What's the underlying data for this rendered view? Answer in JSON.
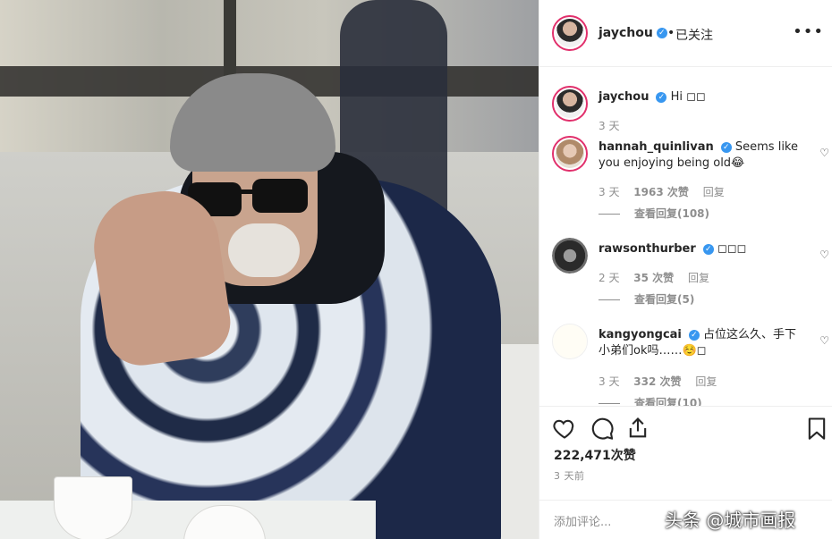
{
  "post": {
    "username": "jaychou",
    "follow_status": "已关注",
    "dot": "•",
    "more_icon": "more-horizontal-icon"
  },
  "comments": [
    {
      "user": "jaychou",
      "text": "Hi ◻◻",
      "time": "3 天",
      "likes": "",
      "reply": "",
      "view_replies": ""
    },
    {
      "user": "hannah_quinlivan",
      "text": "Seems like you enjoying being old😂",
      "time": "3 天",
      "likes": "1963 次赞",
      "reply": "回复",
      "view_replies": "查看回复(108)"
    },
    {
      "user": "rawsonthurber",
      "text": "◻◻◻",
      "time": "2 天",
      "likes": "35 次赞",
      "reply": "回复",
      "view_replies": "查看回复(5)"
    },
    {
      "user": "kangyongcai",
      "text": "占位这么久、手下小弟们ok吗……☺️◻",
      "time": "3 天",
      "likes": "332 次赞",
      "reply": "回复",
      "view_replies": "查看回复(10)"
    }
  ],
  "actions": {
    "like_icon": "heart-icon",
    "comment_icon": "comment-icon",
    "share_icon": "share-icon",
    "save_icon": "bookmark-icon"
  },
  "likes_total": "222,471次赞",
  "posted_time": "3 天前",
  "add_comment_placeholder": "添加评论...",
  "watermark": "头条 @城市画报",
  "colors": {
    "verified": "#3897f0",
    "story_ring": "#e1306c",
    "meta": "#8e8e8e"
  }
}
